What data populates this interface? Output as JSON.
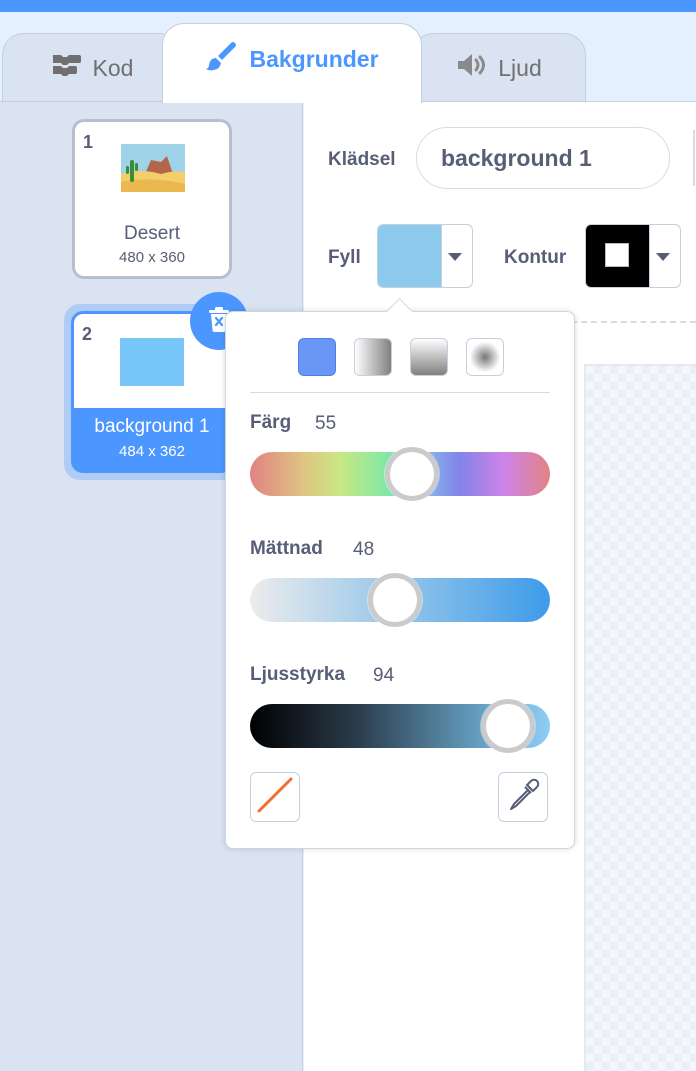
{
  "tabs": [
    {
      "label": "Kod",
      "icon": "code-blocks-icon"
    },
    {
      "label": "Bakgrunder",
      "icon": "paintbrush-icon",
      "active": true
    },
    {
      "label": "Ljud",
      "icon": "speaker-icon"
    }
  ],
  "backdrops": [
    {
      "number": "1",
      "name": "Desert",
      "size": "480 x 360"
    },
    {
      "number": "2",
      "name": "background 1",
      "size": "484 x 362",
      "selected": true
    }
  ],
  "editor": {
    "costume_label": "Klädsel",
    "costume_name": "background 1",
    "fill_label": "Fyll",
    "fill_color": "#8dcbee",
    "outline_label": "Kontur",
    "outline_color": "#000000"
  },
  "color_picker": {
    "hue": {
      "label": "Färg",
      "value": "55"
    },
    "saturation": {
      "label": "Mättnad",
      "value": "48"
    },
    "brightness": {
      "label": "Ljusstyrka",
      "value": "94"
    },
    "gradient_modes": [
      "solid",
      "horizontal",
      "vertical",
      "radial"
    ],
    "selected_mode": "solid"
  },
  "colors": {
    "accent": "#4c97ff",
    "sidebar_bg": "#d9e3f2",
    "text": "#575e75"
  }
}
